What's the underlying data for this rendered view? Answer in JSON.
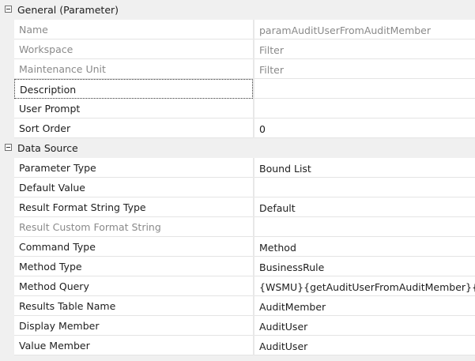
{
  "categories": [
    {
      "label": "General (Parameter)",
      "properties": [
        {
          "name": "Name",
          "value": "paramAuditUserFromAuditMember",
          "readonly": true
        },
        {
          "name": "Workspace",
          "value": "Filter",
          "readonly": true
        },
        {
          "name": "Maintenance Unit",
          "value": "Filter",
          "readonly": true
        },
        {
          "name": "Description",
          "value": "",
          "readonly": false,
          "focused": true
        },
        {
          "name": "User Prompt",
          "value": "",
          "readonly": false
        },
        {
          "name": "Sort Order",
          "value": "0",
          "readonly": false
        }
      ]
    },
    {
      "label": "Data Source",
      "properties": [
        {
          "name": "Parameter Type",
          "value": "Bound List",
          "readonly": false
        },
        {
          "name": "Default Value",
          "value": "",
          "readonly": false
        },
        {
          "name": "Result Format String Type",
          "value": "Default",
          "readonly": false
        },
        {
          "name": "Result Custom Format String",
          "value": "",
          "readonly": true
        },
        {
          "name": "Command Type",
          "value": "Method",
          "readonly": false
        },
        {
          "name": "Method Type",
          "value": "BusinessRule",
          "readonly": false
        },
        {
          "name": "Method Query",
          "value": "{WSMU}{getAuditUserFromAuditMember}{}",
          "readonly": false
        },
        {
          "name": "Results Table Name",
          "value": "AuditMember",
          "readonly": false
        },
        {
          "name": "Display Member",
          "value": "AuditUser",
          "readonly": false
        },
        {
          "name": "Value Member",
          "value": "AuditUser",
          "readonly": false
        }
      ]
    }
  ]
}
